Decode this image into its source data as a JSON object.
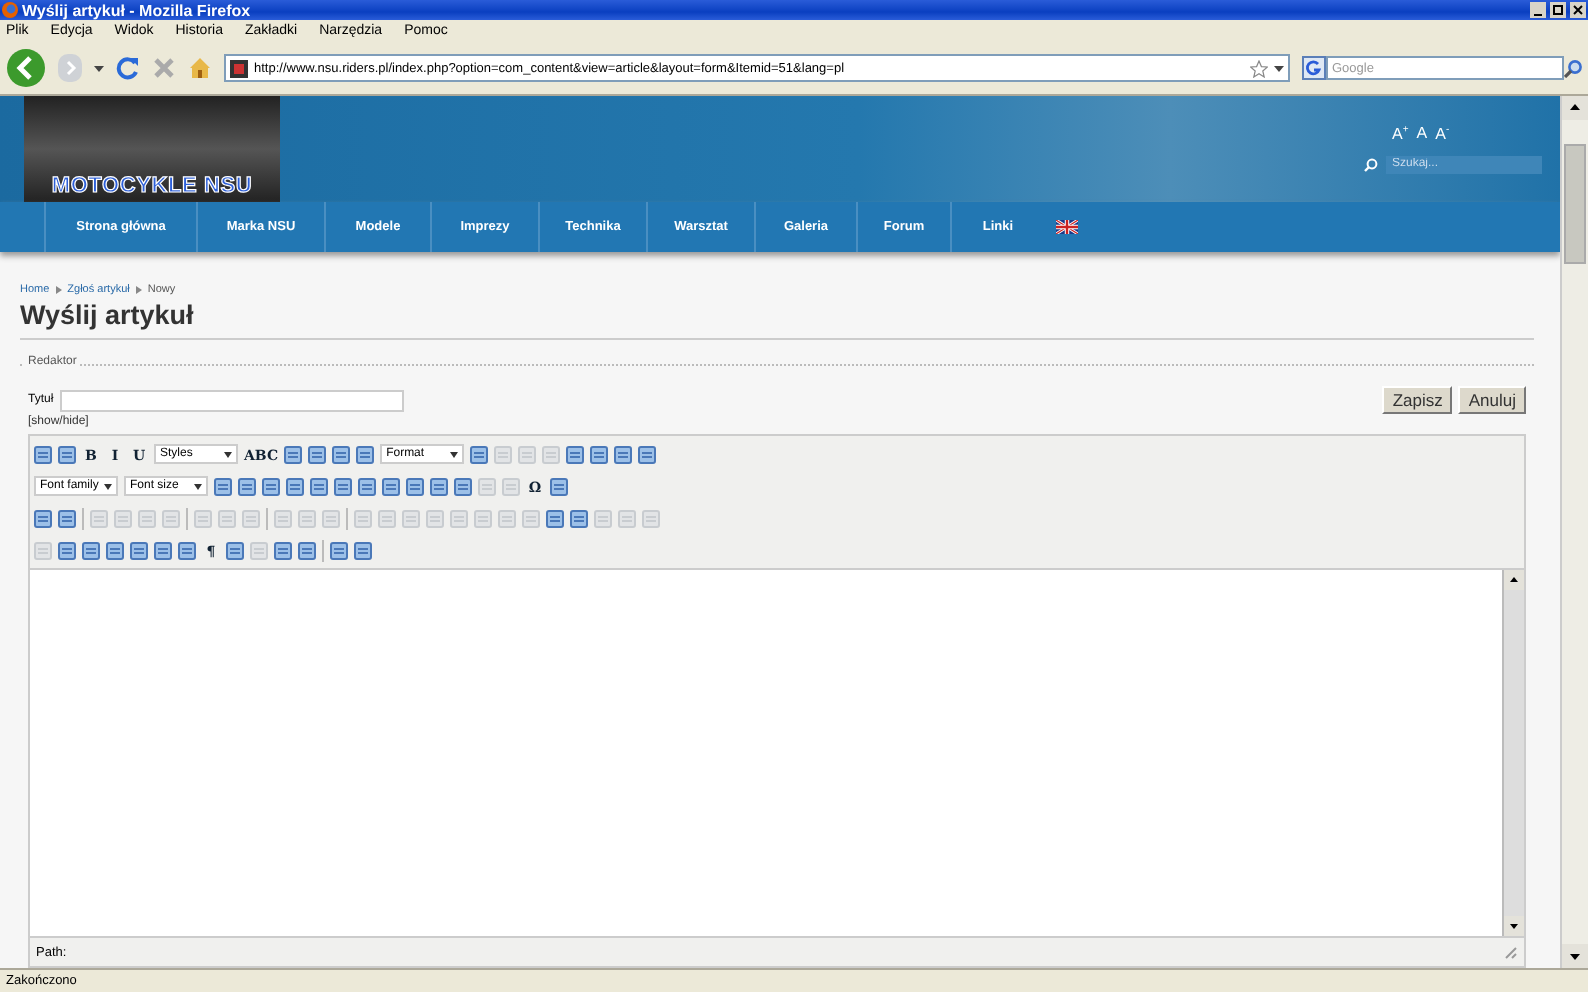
{
  "window": {
    "title": "Wyślij artykuł - Mozilla Firefox"
  },
  "menu": [
    "Plik",
    "Edycja",
    "Widok",
    "Historia",
    "Zakładki",
    "Narzędzia",
    "Pomoc"
  ],
  "address_bar": {
    "value": "http://www.nsu.riders.pl/index.php?option=com_content&view=article&layout=form&Itemid=51&lang=pl"
  },
  "search_bar": {
    "placeholder": "Google"
  },
  "site": {
    "logo": "MOTOCYKLE NSU",
    "font_sizes": [
      "A$^{+}$",
      "A",
      "A$^{-}$"
    ],
    "search": {
      "placeholder": "Szukaj..."
    },
    "nav": [
      "Strona główna",
      "Marka NSU",
      "Modele",
      "Imprezy",
      "Technika",
      "Warsztat",
      "Galeria",
      "Forum",
      "Linki"
    ]
  },
  "breadcrumb": [
    "Home",
    "Zgłoś artykuł",
    "Nowy"
  ],
  "page_title": "Wyślij artykuł",
  "fieldset": {
    "legend": "Redaktor",
    "title_label": "Tytuł",
    "buttons": [
      "Zapisz",
      "Anuluj"
    ],
    "toggle": "[show/hide]"
  },
  "toolbar_rows": [
    [
      {
        "kind": "icon",
        "disabled": false
      },
      {
        "kind": "icon",
        "disabled": false
      },
      {
        "kind": "text",
        "label": "B"
      },
      {
        "kind": "text",
        "label": "I"
      },
      {
        "kind": "text",
        "label": "U"
      },
      {
        "kind": "select",
        "label": "Styles"
      },
      {
        "kind": "text",
        "label": "ABC"
      },
      {
        "kind": "icon",
        "disabled": false
      },
      {
        "kind": "icon",
        "disabled": false
      },
      {
        "kind": "icon",
        "disabled": false
      },
      {
        "kind": "icon",
        "disabled": false
      },
      {
        "kind": "select",
        "label": "Format"
      },
      {
        "kind": "icon",
        "disabled": false
      },
      {
        "kind": "icon",
        "disabled": true
      },
      {
        "kind": "icon",
        "disabled": true
      },
      {
        "kind": "icon",
        "disabled": true
      },
      {
        "kind": "icon",
        "disabled": false
      },
      {
        "kind": "icon",
        "disabled": false
      },
      {
        "kind": "icon",
        "disabled": false
      },
      {
        "kind": "icon",
        "disabled": false
      }
    ],
    [
      {
        "kind": "select",
        "label": "Font family"
      },
      {
        "kind": "select",
        "label": "Font size"
      },
      {
        "kind": "icon",
        "disabled": false
      },
      {
        "kind": "icon",
        "disabled": false
      },
      {
        "kind": "icon",
        "disabled": false
      },
      {
        "kind": "icon",
        "disabled": false
      },
      {
        "kind": "icon",
        "disabled": false
      },
      {
        "kind": "icon",
        "disabled": false
      },
      {
        "kind": "icon",
        "disabled": false
      },
      {
        "kind": "icon",
        "disabled": false
      },
      {
        "kind": "icon",
        "disabled": false
      },
      {
        "kind": "icon",
        "disabled": false
      },
      {
        "kind": "icon",
        "disabled": false
      },
      {
        "kind": "icon",
        "disabled": true
      },
      {
        "kind": "icon",
        "disabled": true
      },
      {
        "kind": "text",
        "label": "Ω"
      },
      {
        "kind": "icon",
        "disabled": false
      }
    ],
    [
      {
        "kind": "icon",
        "disabled": false
      },
      {
        "kind": "icon",
        "disabled": false
      },
      {
        "kind": "sep"
      },
      {
        "kind": "icon",
        "disabled": true
      },
      {
        "kind": "icon",
        "disabled": true
      },
      {
        "kind": "icon",
        "disabled": true
      },
      {
        "kind": "icon",
        "disabled": true
      },
      {
        "kind": "sep"
      },
      {
        "kind": "icon",
        "disabled": true
      },
      {
        "kind": "icon",
        "disabled": true
      },
      {
        "kind": "icon",
        "disabled": true
      },
      {
        "kind": "sep"
      },
      {
        "kind": "icon",
        "disabled": true
      },
      {
        "kind": "icon",
        "disabled": true
      },
      {
        "kind": "icon",
        "disabled": true
      },
      {
        "kind": "sep"
      },
      {
        "kind": "icon",
        "disabled": true
      },
      {
        "kind": "icon",
        "disabled": true
      },
      {
        "kind": "icon",
        "disabled": true
      },
      {
        "kind": "icon",
        "disabled": true
      },
      {
        "kind": "icon",
        "disabled": true
      },
      {
        "kind": "icon",
        "disabled": true
      },
      {
        "kind": "icon",
        "disabled": true
      },
      {
        "kind": "icon",
        "disabled": true
      },
      {
        "kind": "icon",
        "disabled": false
      },
      {
        "kind": "icon",
        "disabled": false
      },
      {
        "kind": "icon",
        "disabled": true
      },
      {
        "kind": "icon",
        "disabled": true
      },
      {
        "kind": "icon",
        "disabled": true
      }
    ],
    [
      {
        "kind": "icon",
        "disabled": true
      },
      {
        "kind": "icon",
        "disabled": false
      },
      {
        "kind": "icon",
        "disabled": false
      },
      {
        "kind": "icon",
        "disabled": false
      },
      {
        "kind": "icon",
        "disabled": false
      },
      {
        "kind": "icon",
        "disabled": false
      },
      {
        "kind": "icon",
        "disabled": false
      },
      {
        "kind": "text",
        "label": "¶"
      },
      {
        "kind": "icon",
        "disabled": false
      },
      {
        "kind": "icon",
        "disabled": true
      },
      {
        "kind": "icon",
        "disabled": false
      },
      {
        "kind": "icon",
        "disabled": false
      },
      {
        "kind": "sep"
      },
      {
        "kind": "icon",
        "disabled": false
      },
      {
        "kind": "icon",
        "disabled": false
      }
    ]
  ],
  "editor": {
    "path_label": "Path:"
  },
  "status_bar": "Zakończono"
}
